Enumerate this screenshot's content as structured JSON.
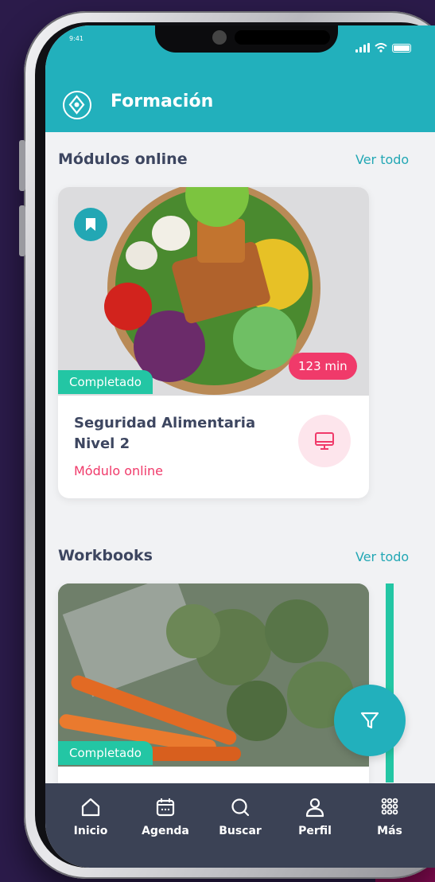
{
  "status_bar": {
    "time": "9:41"
  },
  "header": {
    "title": "Formación"
  },
  "sections": {
    "online": {
      "title": "Módulos online",
      "see_all": "Ver todo"
    },
    "workbooks": {
      "title": "Workbooks",
      "see_all": "Ver todo"
    }
  },
  "online_card": {
    "badge": "Completado",
    "duration": "123 min",
    "title": "Seguridad Alimentaria Nivel 2",
    "subtitle": "Módulo online",
    "icon": "monitor-icon"
  },
  "workbook_card": {
    "badge": "Completado"
  },
  "bottom_nav": [
    {
      "label": "Inicio",
      "icon": "home-icon"
    },
    {
      "label": "Agenda",
      "icon": "calendar-icon"
    },
    {
      "label": "Buscar",
      "icon": "search-icon"
    },
    {
      "label": "Perfil",
      "icon": "user-icon"
    },
    {
      "label": "Más",
      "icon": "grid-dots-icon"
    }
  ],
  "colors": {
    "primary": "#22b0bc",
    "accent": "#f03a6a",
    "completed": "#23c6a4",
    "nav_bg": "#3b4255",
    "background": "#2b1b4a"
  }
}
